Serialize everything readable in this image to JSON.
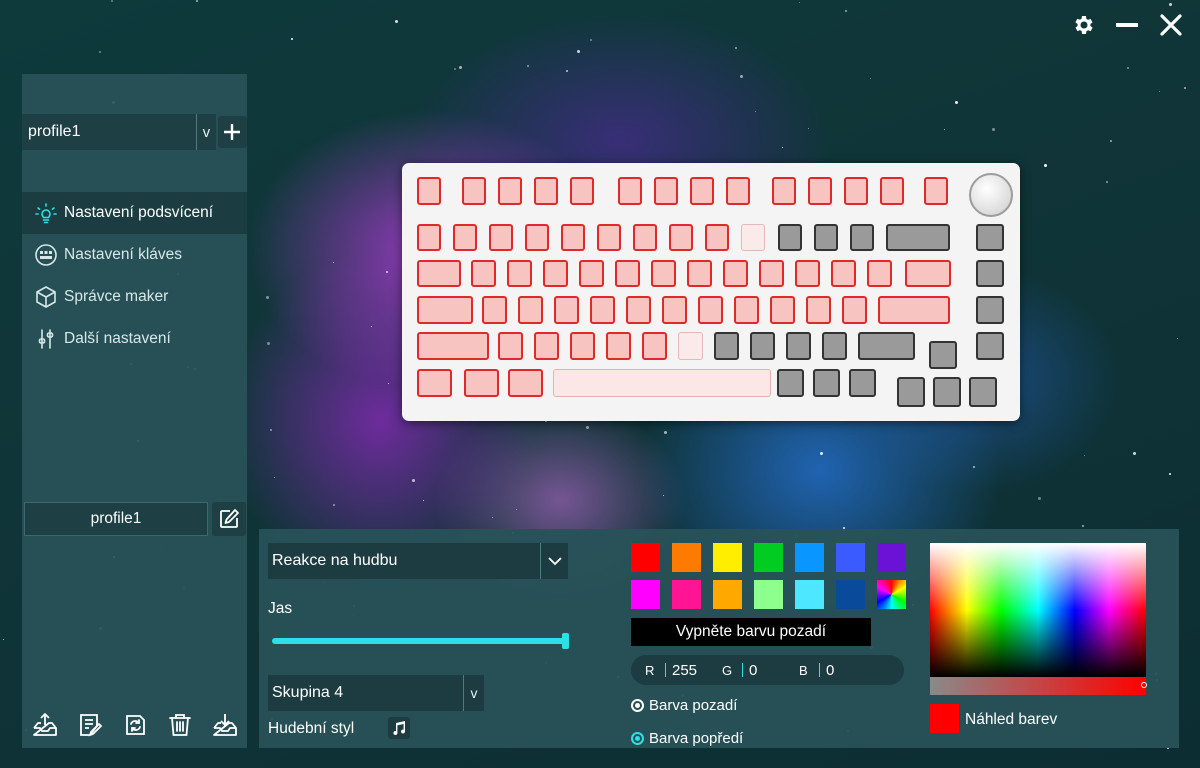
{
  "window": {
    "controls": [
      {
        "icon": "gear-icon"
      },
      {
        "icon": "minimize-icon"
      },
      {
        "icon": "close-icon"
      }
    ]
  },
  "sidebar": {
    "profile_select": {
      "value": "profile1",
      "caret": "v"
    },
    "add_icon": "plus-icon",
    "nav": [
      {
        "label": "Nastavení podsvícení",
        "icon": "lightbulb-icon",
        "active": true
      },
      {
        "label": "Nastavení kláves",
        "icon": "keyboard-icon",
        "active": false
      },
      {
        "label": "Správce maker",
        "icon": "cube-icon",
        "active": false
      },
      {
        "label": "Další nastavení",
        "icon": "sliders-icon",
        "active": false
      }
    ],
    "profile_name": "profile1",
    "tools": [
      {
        "icon": "import-icon"
      },
      {
        "icon": "notes-icon"
      },
      {
        "icon": "refresh-icon"
      },
      {
        "icon": "trash-icon"
      },
      {
        "icon": "export-icon"
      }
    ]
  },
  "lighting": {
    "mode_select": "Reakce na hudbu",
    "brightness_label": "Jas",
    "brightness_level": 1.0,
    "group_select": "Skupina 4",
    "group_caret": "v",
    "music_style_label": "Hudební styl",
    "swatches": [
      "#ff0000",
      "#ff7a00",
      "#ffee00",
      "#00cc22",
      "#0a96ff",
      "#3a5bff",
      "#6a12d6",
      "#ff00ff",
      "#ff1493",
      "#ffa800",
      "#8cff8c",
      "#4de8ff",
      "#0a4a9a",
      "rainbow"
    ],
    "bg_off_button": "Vypněte barvu pozadí",
    "rgb": {
      "r_label": "R",
      "r": "255",
      "g_label": "G",
      "g": "0",
      "b_label": "B",
      "b": "0"
    },
    "radio_background": {
      "label": "Barva pozadí",
      "checked": true
    },
    "radio_foreground": {
      "label": "Barva popředí",
      "checked": true
    },
    "preview_color": "#ff0000",
    "preview_label": "Náhled barev"
  }
}
